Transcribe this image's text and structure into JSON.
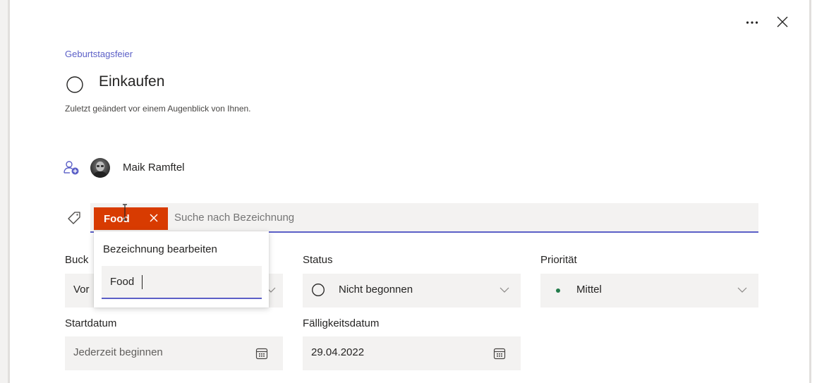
{
  "task": {
    "plan_name": "Geburtstagsfeier",
    "title": "Einkaufen",
    "last_modified": "Zuletzt geändert vor einem Augenblick von Ihnen."
  },
  "assignee": {
    "name": "Maik Ramftel"
  },
  "labels": {
    "chip_text": "Food",
    "chip_color": "#d83b01",
    "search_placeholder": "Suche nach Bezeichnung"
  },
  "edit_label_popover": {
    "title": "Bezeichnung bearbeiten",
    "input_value": "Food"
  },
  "fields": {
    "bucket": {
      "label": "Buck",
      "value": "Vor"
    },
    "status": {
      "label": "Status",
      "value": "Nicht begonnen"
    },
    "priority": {
      "label": "Priorität",
      "value": "Mittel",
      "dot_color": "#237b4b"
    },
    "start_date": {
      "label": "Startdatum",
      "value": "Jederzeit beginnen"
    },
    "due_date": {
      "label": "Fälligkeitsdatum",
      "value": "29.04.2022"
    }
  },
  "colors": {
    "accent": "#5b5fc7",
    "field_bg": "#f3f2f1"
  },
  "icons": [
    "more-options-icon",
    "close-icon",
    "complete-circle-icon",
    "assign-user-icon",
    "tag-icon",
    "chevron-down-icon",
    "calendar-icon"
  ]
}
